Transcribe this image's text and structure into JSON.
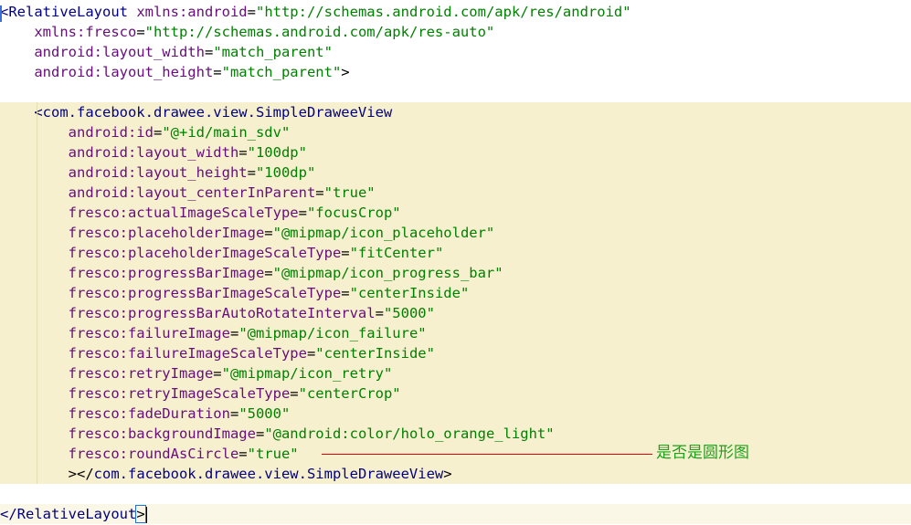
{
  "lines": [
    {
      "indent": "",
      "parts": [
        {
          "c": "tag",
          "t": "<RelativeLayout "
        },
        {
          "c": "attr",
          "t": "xmlns:android"
        },
        {
          "c": "punct",
          "t": "="
        },
        {
          "c": "val",
          "t": "\"http://schemas.android.com/apk/res/android\""
        }
      ]
    },
    {
      "indent": "    ",
      "parts": [
        {
          "c": "attr",
          "t": "xmlns:fresco"
        },
        {
          "c": "punct",
          "t": "="
        },
        {
          "c": "val",
          "t": "\"http://schemas.android.com/apk/res-auto\""
        }
      ]
    },
    {
      "indent": "    ",
      "parts": [
        {
          "c": "attr",
          "t": "android:layout_width"
        },
        {
          "c": "punct",
          "t": "="
        },
        {
          "c": "val",
          "t": "\"match_parent\""
        }
      ]
    },
    {
      "indent": "    ",
      "parts": [
        {
          "c": "attr",
          "t": "android:layout_height"
        },
        {
          "c": "punct",
          "t": "="
        },
        {
          "c": "val",
          "t": "\"match_parent\""
        },
        {
          "c": "punct",
          "t": ">"
        }
      ]
    },
    {
      "indent": "",
      "parts": []
    },
    {
      "indent": "    ",
      "parts": [
        {
          "c": "tag",
          "t": "<com.facebook.drawee.view.SimpleDraweeView"
        }
      ]
    },
    {
      "indent": "        ",
      "parts": [
        {
          "c": "attr",
          "t": "android:id"
        },
        {
          "c": "punct",
          "t": "="
        },
        {
          "c": "val",
          "t": "\"@+id/main_sdv\""
        }
      ]
    },
    {
      "indent": "        ",
      "parts": [
        {
          "c": "attr",
          "t": "android:layout_width"
        },
        {
          "c": "punct",
          "t": "="
        },
        {
          "c": "val",
          "t": "\"100dp\""
        }
      ]
    },
    {
      "indent": "        ",
      "parts": [
        {
          "c": "attr",
          "t": "android:layout_height"
        },
        {
          "c": "punct",
          "t": "="
        },
        {
          "c": "val",
          "t": "\"100dp\""
        }
      ]
    },
    {
      "indent": "        ",
      "parts": [
        {
          "c": "attr",
          "t": "android:layout_centerInParent"
        },
        {
          "c": "punct",
          "t": "="
        },
        {
          "c": "val",
          "t": "\"true\""
        }
      ]
    },
    {
      "indent": "        ",
      "parts": [
        {
          "c": "attr",
          "t": "fresco:actualImageScaleType"
        },
        {
          "c": "punct",
          "t": "="
        },
        {
          "c": "val",
          "t": "\"focusCrop\""
        }
      ]
    },
    {
      "indent": "        ",
      "parts": [
        {
          "c": "attr",
          "t": "fresco:placeholderImage"
        },
        {
          "c": "punct",
          "t": "="
        },
        {
          "c": "val",
          "t": "\"@mipmap/icon_placeholder\""
        }
      ]
    },
    {
      "indent": "        ",
      "parts": [
        {
          "c": "attr",
          "t": "fresco:placeholderImageScaleType"
        },
        {
          "c": "punct",
          "t": "="
        },
        {
          "c": "val",
          "t": "\"fitCenter\""
        }
      ]
    },
    {
      "indent": "        ",
      "parts": [
        {
          "c": "attr",
          "t": "fresco:progressBarImage"
        },
        {
          "c": "punct",
          "t": "="
        },
        {
          "c": "val",
          "t": "\"@mipmap/icon_progress_bar\""
        }
      ]
    },
    {
      "indent": "        ",
      "parts": [
        {
          "c": "attr",
          "t": "fresco:progressBarImageScaleType"
        },
        {
          "c": "punct",
          "t": "="
        },
        {
          "c": "val",
          "t": "\"centerInside\""
        }
      ]
    },
    {
      "indent": "        ",
      "parts": [
        {
          "c": "attr",
          "t": "fresco:progressBarAutoRotateInterval"
        },
        {
          "c": "punct",
          "t": "="
        },
        {
          "c": "val",
          "t": "\"5000\""
        }
      ]
    },
    {
      "indent": "        ",
      "parts": [
        {
          "c": "attr",
          "t": "fresco:failureImage"
        },
        {
          "c": "punct",
          "t": "="
        },
        {
          "c": "val",
          "t": "\"@mipmap/icon_failure\""
        }
      ]
    },
    {
      "indent": "        ",
      "parts": [
        {
          "c": "attr",
          "t": "fresco:failureImageScaleType"
        },
        {
          "c": "punct",
          "t": "="
        },
        {
          "c": "val",
          "t": "\"centerInside\""
        }
      ]
    },
    {
      "indent": "        ",
      "parts": [
        {
          "c": "attr",
          "t": "fresco:retryImage"
        },
        {
          "c": "punct",
          "t": "="
        },
        {
          "c": "val",
          "t": "\"@mipmap/icon_retry\""
        }
      ]
    },
    {
      "indent": "        ",
      "parts": [
        {
          "c": "attr",
          "t": "fresco:retryImageScaleType"
        },
        {
          "c": "punct",
          "t": "="
        },
        {
          "c": "val",
          "t": "\"centerCrop\""
        }
      ]
    },
    {
      "indent": "        ",
      "parts": [
        {
          "c": "attr",
          "t": "fresco:fadeDuration"
        },
        {
          "c": "punct",
          "t": "="
        },
        {
          "c": "val",
          "t": "\"5000\""
        }
      ]
    },
    {
      "indent": "        ",
      "parts": [
        {
          "c": "attr",
          "t": "fresco:backgroundImage"
        },
        {
          "c": "punct",
          "t": "="
        },
        {
          "c": "val",
          "t": "\"@android:color/holo_orange_light\""
        }
      ]
    },
    {
      "indent": "        ",
      "parts": [
        {
          "c": "attr",
          "t": "fresco:roundAsCircle"
        },
        {
          "c": "punct",
          "t": "="
        },
        {
          "c": "val",
          "t": "\"true\""
        }
      ]
    },
    {
      "indent": "        ",
      "parts": [
        {
          "c": "punct",
          "t": "></"
        },
        {
          "c": "tag",
          "t": "com.facebook.drawee.view.SimpleDraweeView"
        },
        {
          "c": "punct",
          "t": ">"
        }
      ]
    },
    {
      "indent": "",
      "parts": []
    },
    {
      "indent": "",
      "parts": [
        {
          "c": "tag",
          "t": "</RelativeLayout"
        },
        {
          "c": "punct",
          "t": ">"
        }
      ]
    }
  ],
  "annotation": {
    "text": "是否是圆形图",
    "line_color": "#e00000",
    "text_color": "#1aa31a"
  },
  "colors": {
    "tag": "#000080",
    "attribute": "#660e7a",
    "value": "#008000",
    "highlight": "#f7f0cf"
  }
}
